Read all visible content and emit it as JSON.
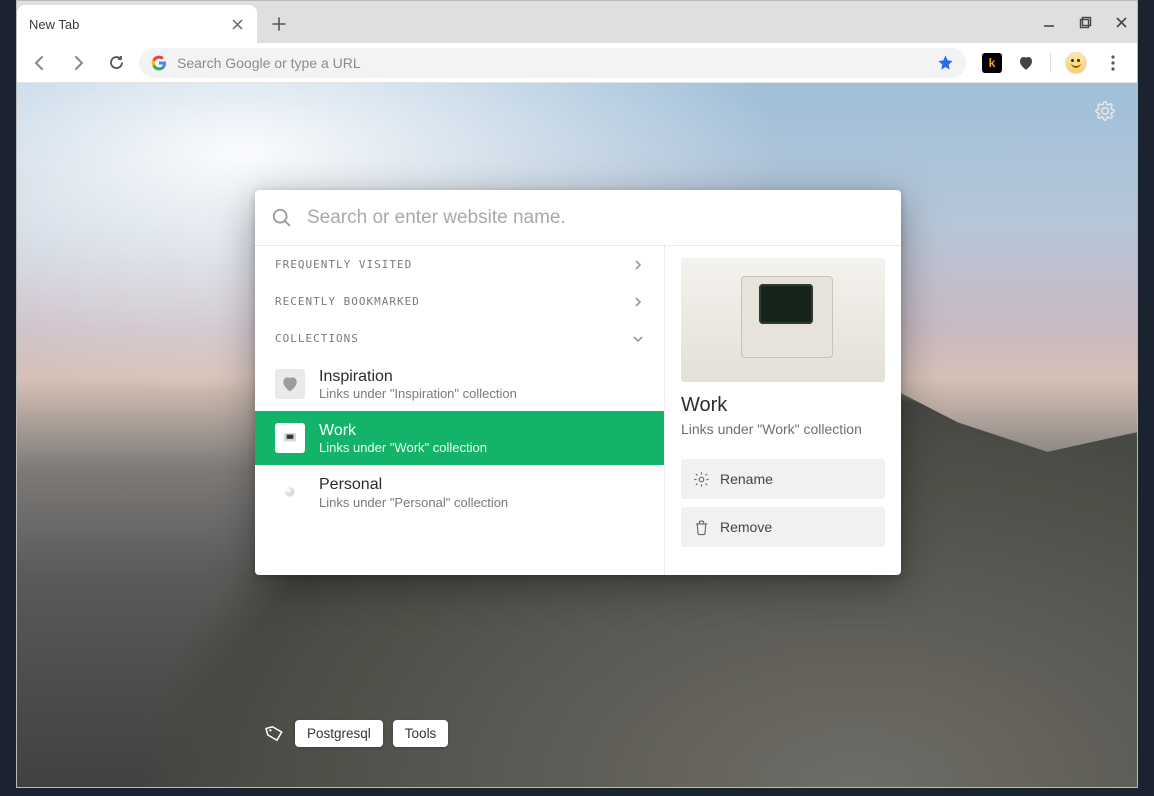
{
  "browser": {
    "tab_title": "New Tab",
    "omnibox_placeholder": "Search Google or type a URL"
  },
  "launcher": {
    "search_placeholder": "Search or enter website name.",
    "sections": {
      "frequently_visited": "FREQUENTLY VISITED",
      "recently_bookmarked": "RECENTLY BOOKMARKED",
      "collections": "COLLECTIONS"
    },
    "collections": [
      {
        "title": "Inspiration",
        "sub": "Links under \"Inspiration\" collection",
        "selected": false
      },
      {
        "title": "Work",
        "sub": "Links under \"Work\" collection",
        "selected": true
      },
      {
        "title": "Personal",
        "sub": "Links under \"Personal\" collection",
        "selected": false
      }
    ],
    "detail": {
      "title": "Work",
      "sub": "Links under \"Work\" collection",
      "rename_label": "Rename",
      "remove_label": "Remove"
    },
    "tags": [
      {
        "label": "Postgresql"
      },
      {
        "label": "Tools"
      }
    ]
  }
}
